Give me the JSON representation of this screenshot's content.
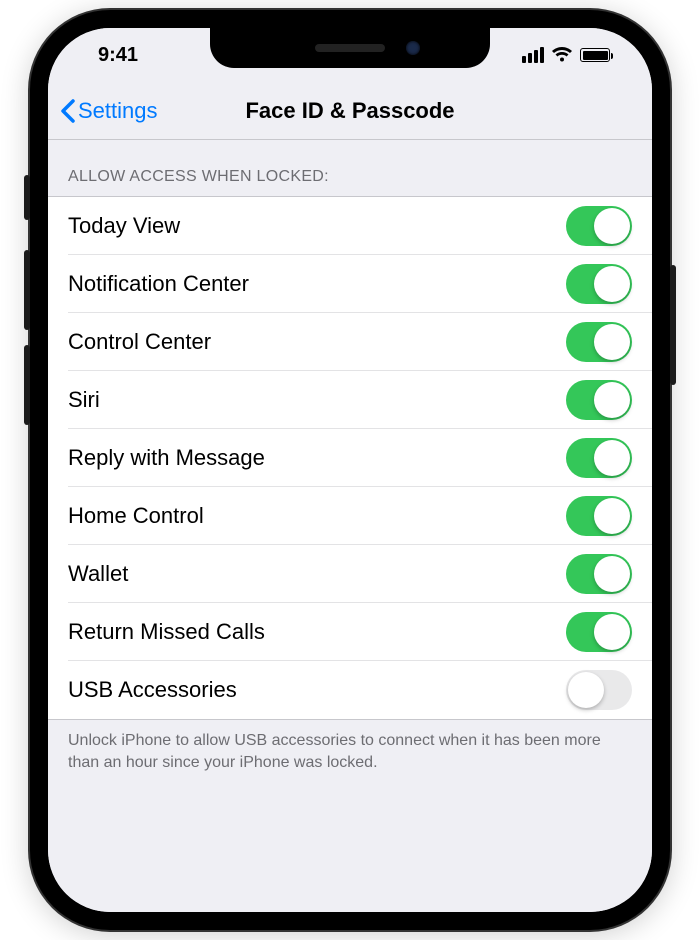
{
  "status": {
    "time": "9:41"
  },
  "nav": {
    "back_label": "Settings",
    "title": "Face ID & Passcode"
  },
  "section": {
    "header": "ALLOW ACCESS WHEN LOCKED:",
    "footer": "Unlock iPhone to allow USB accessories to connect when it has been more than an hour since your iPhone was locked."
  },
  "rows": [
    {
      "label": "Today View",
      "on": true
    },
    {
      "label": "Notification Center",
      "on": true
    },
    {
      "label": "Control Center",
      "on": true
    },
    {
      "label": "Siri",
      "on": true
    },
    {
      "label": "Reply with Message",
      "on": true
    },
    {
      "label": "Home Control",
      "on": true
    },
    {
      "label": "Wallet",
      "on": true
    },
    {
      "label": "Return Missed Calls",
      "on": true
    },
    {
      "label": "USB Accessories",
      "on": false
    }
  ]
}
